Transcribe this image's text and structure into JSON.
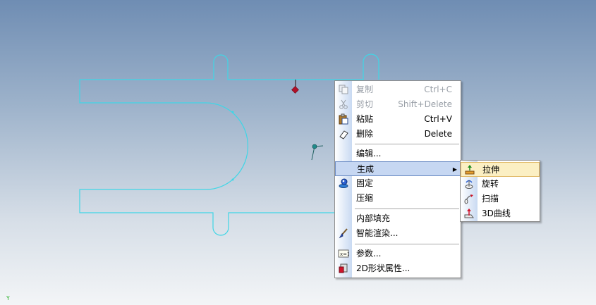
{
  "canvas": {
    "background_top": "#6f8db3",
    "background_bottom": "#f3f5f7",
    "profile_color": "#3fd6e6",
    "anchor_color": "#c0102a",
    "axis_label": "Y"
  },
  "context_menu": {
    "items": [
      {
        "label": "复制",
        "shortcut": "Ctrl+C",
        "icon": "copy-icon",
        "enabled": false
      },
      {
        "label": "剪切",
        "shortcut": "Shift+Delete",
        "icon": "scissors-icon",
        "enabled": false
      },
      {
        "label": "粘贴",
        "shortcut": "Ctrl+V",
        "icon": "paste-icon",
        "enabled": true
      },
      {
        "label": "删除",
        "shortcut": "Delete",
        "icon": "eraser-icon",
        "enabled": true
      },
      {
        "label": "编辑...",
        "shortcut": "",
        "icon": "",
        "enabled": true
      },
      {
        "label": "生成",
        "shortcut": "",
        "icon": "",
        "enabled": true,
        "has_submenu": true,
        "highlighted": true
      },
      {
        "label": "固定",
        "shortcut": "",
        "icon": "pin-icon",
        "enabled": true
      },
      {
        "label": "压缩",
        "shortcut": "",
        "icon": "",
        "enabled": true
      },
      {
        "label": "内部填充",
        "shortcut": "",
        "icon": "",
        "enabled": true
      },
      {
        "label": "智能渲染...",
        "shortcut": "",
        "icon": "paintbrush-icon",
        "enabled": true
      },
      {
        "label": "参数...",
        "shortcut": "",
        "icon": "parameter-icon",
        "enabled": true
      },
      {
        "label": "2D形状属性...",
        "shortcut": "",
        "icon": "shape-properties-icon",
        "enabled": true
      }
    ]
  },
  "submenu": {
    "items": [
      {
        "label": "拉伸",
        "icon": "extrude-icon",
        "highlighted": true
      },
      {
        "label": "旋转",
        "icon": "revolve-icon"
      },
      {
        "label": "扫描",
        "icon": "sweep-icon"
      },
      {
        "label": "3D曲线",
        "icon": "3d-curve-icon"
      }
    ]
  },
  "colors": {
    "menu_highlight": "#c6d7f2",
    "submenu_highlight": "#fbefc3",
    "disabled_text": "#9aa0a8"
  }
}
